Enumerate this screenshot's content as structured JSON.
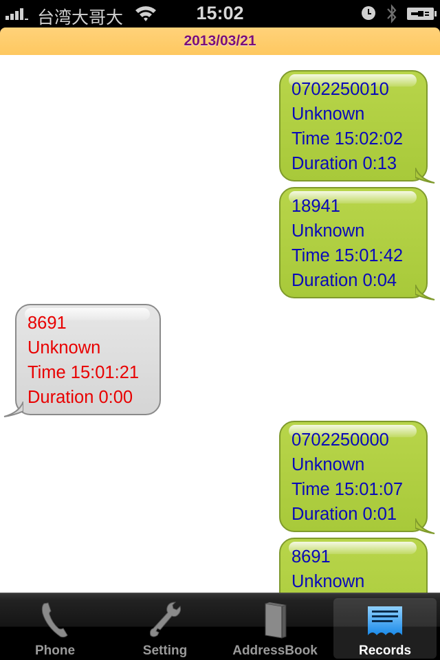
{
  "status_bar": {
    "carrier": "台湾大哥大",
    "time": "15:02",
    "icons": [
      "signal-icon",
      "wifi-icon",
      "alarm-icon",
      "bluetooth-icon",
      "battery-charging-icon"
    ]
  },
  "date_header": "2013/03/21",
  "records": [
    {
      "direction": "outgoing",
      "number": "0702250010",
      "name": "Unknown",
      "time": "Time 15:02:02",
      "duration": "Duration 0:13"
    },
    {
      "direction": "outgoing",
      "number": "18941",
      "name": "Unknown",
      "time": "Time 15:01:42",
      "duration": "Duration 0:04"
    },
    {
      "direction": "incoming",
      "number": "8691",
      "name": "Unknown",
      "time": "Time 15:01:21",
      "duration": "Duration 0:00"
    },
    {
      "direction": "outgoing",
      "number": "0702250000",
      "name": "Unknown",
      "time": "Time 15:01:07",
      "duration": "Duration 0:01"
    },
    {
      "direction": "outgoing",
      "number": "8691",
      "name": "Unknown",
      "time": "",
      "duration": ""
    }
  ],
  "colors": {
    "outgoing_bubble": "#b0cf42",
    "outgoing_text": "#0a0ab8",
    "incoming_bubble": "#dddddd",
    "incoming_text": "#e80000",
    "date_bar": "#fecb68",
    "date_text": "#7a0f7a"
  },
  "tab_bar": {
    "tabs": [
      {
        "label": "Phone",
        "icon": "phone-icon",
        "active": false
      },
      {
        "label": "Setting",
        "icon": "wrench-icon",
        "active": false
      },
      {
        "label": "AddressBook",
        "icon": "book-icon",
        "active": false
      },
      {
        "label": "Records",
        "icon": "records-icon",
        "active": true
      }
    ]
  }
}
